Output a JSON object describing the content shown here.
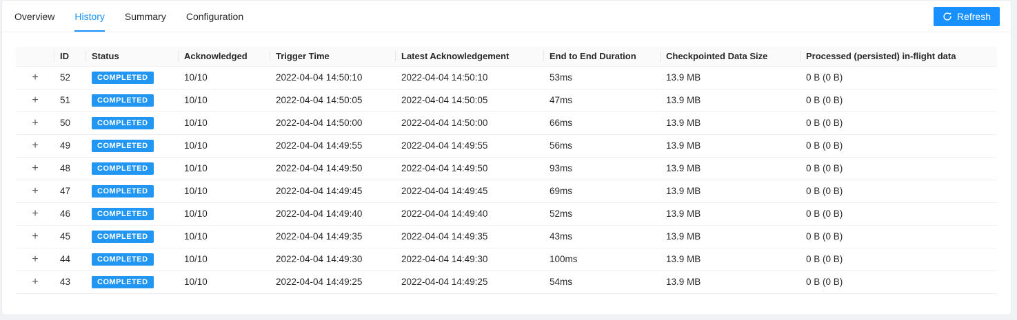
{
  "tabs": [
    {
      "label": "Overview",
      "active": false
    },
    {
      "label": "History",
      "active": true
    },
    {
      "label": "Summary",
      "active": false
    },
    {
      "label": "Configuration",
      "active": false
    }
  ],
  "toolbar": {
    "refresh_label": "Refresh",
    "refresh_icon": "sync-icon"
  },
  "colors": {
    "accent": "#1890ff",
    "badge": "#2196f3",
    "header_bg": "#fafafa",
    "row_border": "#f0f0f0"
  },
  "table": {
    "expand_icon": "+",
    "columns": [
      "",
      "ID",
      "Status",
      "Acknowledged",
      "Trigger Time",
      "Latest Acknowledgement",
      "End to End Duration",
      "Checkpointed Data Size",
      "Processed (persisted) in-flight data"
    ],
    "rows": [
      {
        "id": "52",
        "status": "COMPLETED",
        "acknowledged": "10/10",
        "trigger_time": "2022-04-04 14:50:10",
        "latest_acknowledgement": "2022-04-04 14:50:10",
        "end_to_end_duration": "53ms",
        "checkpointed_data_size": "13.9 MB",
        "processed_in_flight": "0 B (0 B)"
      },
      {
        "id": "51",
        "status": "COMPLETED",
        "acknowledged": "10/10",
        "trigger_time": "2022-04-04 14:50:05",
        "latest_acknowledgement": "2022-04-04 14:50:05",
        "end_to_end_duration": "47ms",
        "checkpointed_data_size": "13.9 MB",
        "processed_in_flight": "0 B (0 B)"
      },
      {
        "id": "50",
        "status": "COMPLETED",
        "acknowledged": "10/10",
        "trigger_time": "2022-04-04 14:50:00",
        "latest_acknowledgement": "2022-04-04 14:50:00",
        "end_to_end_duration": "66ms",
        "checkpointed_data_size": "13.9 MB",
        "processed_in_flight": "0 B (0 B)"
      },
      {
        "id": "49",
        "status": "COMPLETED",
        "acknowledged": "10/10",
        "trigger_time": "2022-04-04 14:49:55",
        "latest_acknowledgement": "2022-04-04 14:49:55",
        "end_to_end_duration": "56ms",
        "checkpointed_data_size": "13.9 MB",
        "processed_in_flight": "0 B (0 B)"
      },
      {
        "id": "48",
        "status": "COMPLETED",
        "acknowledged": "10/10",
        "trigger_time": "2022-04-04 14:49:50",
        "latest_acknowledgement": "2022-04-04 14:49:50",
        "end_to_end_duration": "93ms",
        "checkpointed_data_size": "13.9 MB",
        "processed_in_flight": "0 B (0 B)"
      },
      {
        "id": "47",
        "status": "COMPLETED",
        "acknowledged": "10/10",
        "trigger_time": "2022-04-04 14:49:45",
        "latest_acknowledgement": "2022-04-04 14:49:45",
        "end_to_end_duration": "69ms",
        "checkpointed_data_size": "13.9 MB",
        "processed_in_flight": "0 B (0 B)"
      },
      {
        "id": "46",
        "status": "COMPLETED",
        "acknowledged": "10/10",
        "trigger_time": "2022-04-04 14:49:40",
        "latest_acknowledgement": "2022-04-04 14:49:40",
        "end_to_end_duration": "52ms",
        "checkpointed_data_size": "13.9 MB",
        "processed_in_flight": "0 B (0 B)"
      },
      {
        "id": "45",
        "status": "COMPLETED",
        "acknowledged": "10/10",
        "trigger_time": "2022-04-04 14:49:35",
        "latest_acknowledgement": "2022-04-04 14:49:35",
        "end_to_end_duration": "43ms",
        "checkpointed_data_size": "13.9 MB",
        "processed_in_flight": "0 B (0 B)"
      },
      {
        "id": "44",
        "status": "COMPLETED",
        "acknowledged": "10/10",
        "trigger_time": "2022-04-04 14:49:30",
        "latest_acknowledgement": "2022-04-04 14:49:30",
        "end_to_end_duration": "100ms",
        "checkpointed_data_size": "13.9 MB",
        "processed_in_flight": "0 B (0 B)"
      },
      {
        "id": "43",
        "status": "COMPLETED",
        "acknowledged": "10/10",
        "trigger_time": "2022-04-04 14:49:25",
        "latest_acknowledgement": "2022-04-04 14:49:25",
        "end_to_end_duration": "54ms",
        "checkpointed_data_size": "13.9 MB",
        "processed_in_flight": "0 B (0 B)"
      }
    ]
  }
}
